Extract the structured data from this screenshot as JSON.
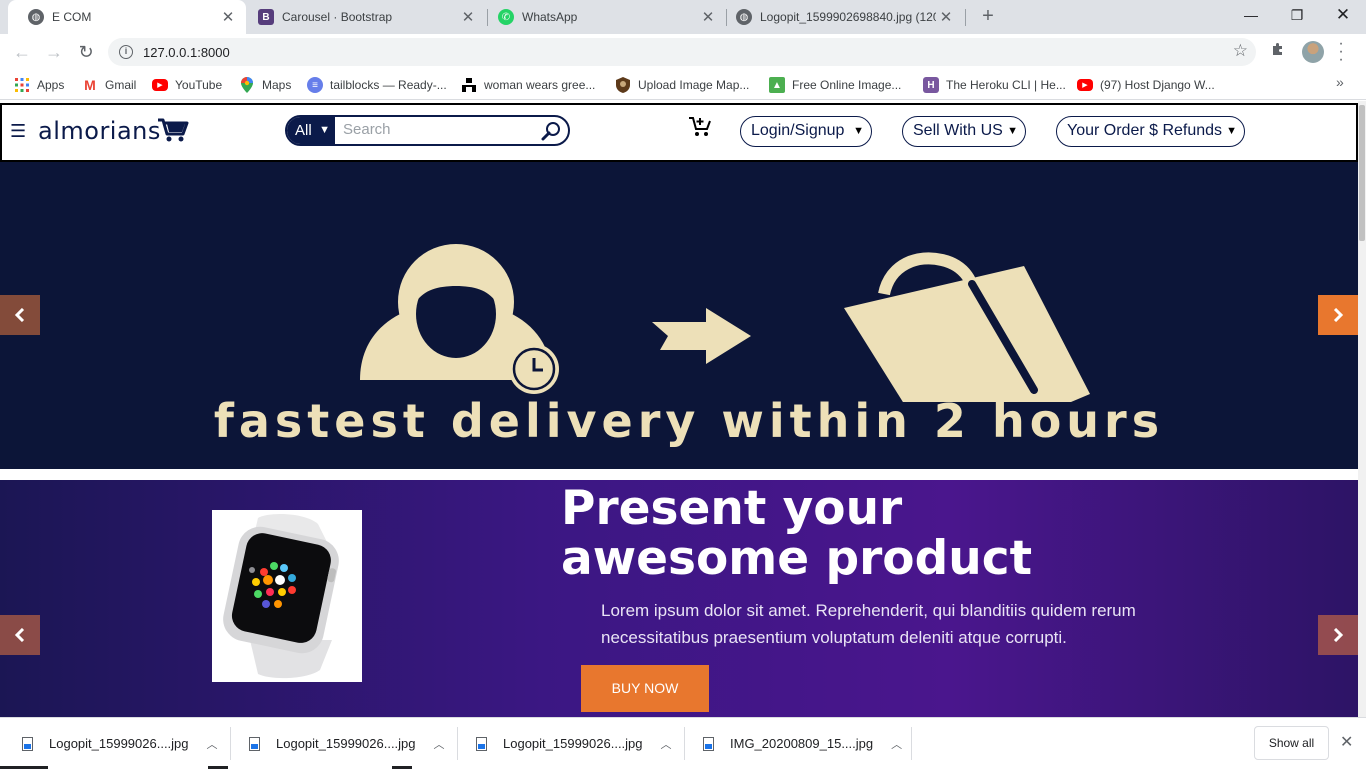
{
  "browser": {
    "tabs": [
      {
        "title": "E COM",
        "icon": "globe-icon",
        "active": true
      },
      {
        "title": "Carousel · Bootstrap",
        "icon": "bootstrap-icon",
        "active": false
      },
      {
        "title": "WhatsApp",
        "icon": "whatsapp-icon",
        "active": false
      },
      {
        "title": "Logopit_1599902698840.jpg (1200",
        "icon": "globe-icon",
        "active": false
      }
    ],
    "url": "127.0.0.1:8000",
    "bookmarks": [
      {
        "label": "Apps",
        "icon": "apps-grid-icon"
      },
      {
        "label": "Gmail",
        "icon": "gmail-icon"
      },
      {
        "label": "YouTube",
        "icon": "youtube-icon"
      },
      {
        "label": "Maps",
        "icon": "maps-icon"
      },
      {
        "label": "tailblocks — Ready-...",
        "icon": "tailblocks-icon"
      },
      {
        "label": "woman wears gree...",
        "icon": "unsplash-icon"
      },
      {
        "label": "Upload Image Map...",
        "icon": "shield-icon"
      },
      {
        "label": "Free Online Image...",
        "icon": "image-icon"
      },
      {
        "label": "The Heroku CLI | He...",
        "icon": "heroku-icon"
      },
      {
        "label": "(97) Host Django W...",
        "icon": "youtube-icon"
      }
    ]
  },
  "site": {
    "logo_text": "almorians",
    "search": {
      "category": "All",
      "placeholder": "Search"
    },
    "nav": {
      "login": "Login/Signup",
      "sell": "Sell With US",
      "orders": "Your Order $ Refunds"
    },
    "slide1": {
      "headline": "fastest delivery within 2 hours"
    },
    "slide2": {
      "title_line1": "Present your",
      "title_line2": "awesome product",
      "body": "Lorem ipsum dolor sit amet. Reprehenderit, qui blanditiis quidem rerum necessitatibus praesentium voluptatum deleniti atque corrupti.",
      "cta": "BUY NOW"
    },
    "colors": {
      "brand_navy": "#0b1a4a",
      "accent_orange": "#e8772e",
      "slide1_bg": "#0c1538",
      "illustration": "#ede0b8"
    }
  },
  "downloads": {
    "items": [
      {
        "name": "Logopit_15999026....jpg"
      },
      {
        "name": "Logopit_15999026....jpg"
      },
      {
        "name": "Logopit_15999026....jpg"
      },
      {
        "name": "IMG_20200809_15....jpg"
      }
    ],
    "show_all": "Show all"
  }
}
